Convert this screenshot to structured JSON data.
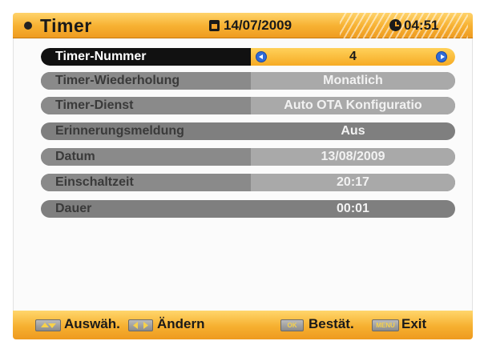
{
  "header": {
    "title": "Timer",
    "date": "14/07/2009",
    "time": "04:51"
  },
  "rows": [
    {
      "label": "Timer-Nummer",
      "value": "4"
    },
    {
      "label": "Timer-Wiederholung",
      "value": "Monatlich"
    },
    {
      "label": "Timer-Dienst",
      "value": "Auto OTA Konfiguratio"
    },
    {
      "label": "Erinnerungsmeldung",
      "value": "Aus"
    },
    {
      "label": "Datum",
      "value": "13/08/2009"
    },
    {
      "label": "Einschaltzeit",
      "value": "20:17"
    },
    {
      "label": "Dauer",
      "value": "00:01"
    }
  ],
  "footer": {
    "select_label": "Auswäh.",
    "change_label": "Ändern",
    "ok_key": "OK",
    "confirm_label": "Bestät.",
    "menu_key": "MENU",
    "exit_label": "Exit"
  },
  "colors": {
    "accent": "#f6ab24",
    "selected_label_bg": "#111111",
    "row_bg": "#7f7f7f",
    "arrow_blue": "#2f6bd8"
  }
}
